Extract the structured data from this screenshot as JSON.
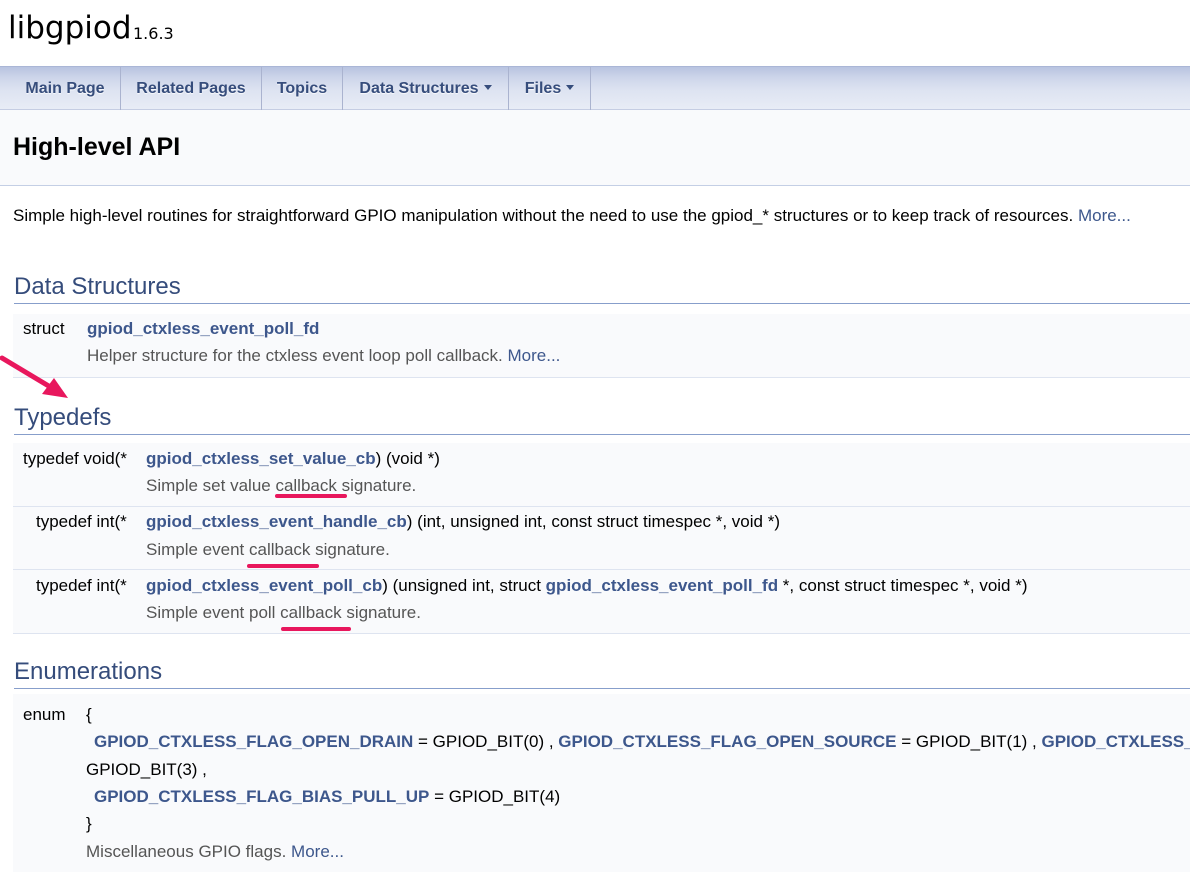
{
  "project": {
    "name": "libgpiod",
    "version": "1.6.3"
  },
  "nav": [
    {
      "label": "Main Page",
      "dropdown": false
    },
    {
      "label": "Related Pages",
      "dropdown": false
    },
    {
      "label": "Topics",
      "dropdown": false
    },
    {
      "label": "Data Structures",
      "dropdown": true
    },
    {
      "label": "Files",
      "dropdown": true
    }
  ],
  "header": {
    "title": "High-level API"
  },
  "brief": {
    "text": "Simple high-level routines for straightforward GPIO manipulation without the need to use the gpiod_* structures or to keep track of resources.",
    "more": "More..."
  },
  "data_structures": {
    "heading": "Data Structures",
    "items": [
      {
        "kind": "struct",
        "name": "gpiod_ctxless_event_poll_fd",
        "desc": "Helper structure for the ctxless event loop poll callback.",
        "more": "More..."
      }
    ]
  },
  "typedefs": {
    "heading": "Typedefs",
    "items": [
      {
        "left": "typedef void(*",
        "name": "gpiod_ctxless_set_value_cb",
        "args": ") (void *)",
        "desc": "Simple set value callback signature."
      },
      {
        "left": "typedef int(*",
        "name": "gpiod_ctxless_event_handle_cb",
        "args": ") (int, unsigned int, const struct timespec *, void *)",
        "desc": "Simple event callback signature."
      },
      {
        "left": "typedef int(*",
        "name": "gpiod_ctxless_event_poll_cb",
        "args_pre": ") (unsigned int, struct ",
        "args_link": "gpiod_ctxless_event_poll_fd",
        "args_post": " *, const struct timespec *, void *)",
        "desc": "Simple event poll callback signature."
      }
    ]
  },
  "enumerations": {
    "heading": "Enumerations",
    "kind": "enum",
    "open_brace": "{",
    "close_brace": "}",
    "line1": [
      {
        "name": "GPIOD_CTXLESS_FLAG_OPEN_DRAIN",
        "value": " = GPIOD_BIT(0) , "
      },
      {
        "name": "GPIOD_CTXLESS_FLAG_OPEN_SOURCE",
        "value": " = GPIOD_BIT(1) , "
      },
      {
        "name": "GPIOD_CTXLESS_FLAG_BIAS_PULL_DOWN",
        "value": ""
      }
    ],
    "line2": "GPIOD_BIT(3) ,",
    "line3": {
      "name": "GPIOD_CTXLESS_FLAG_BIAS_PULL_UP",
      "value": " = GPIOD_BIT(4)"
    },
    "desc": "Miscellaneous GPIO flags.",
    "more": "More..."
  },
  "colors": {
    "link": "#3d578c",
    "section": "#354c7b",
    "annotation": "#e8175d"
  }
}
